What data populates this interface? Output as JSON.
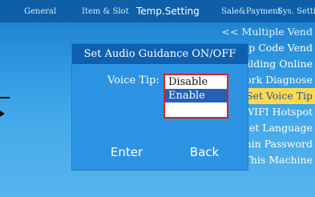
{
  "tabs": [
    "General",
    "Item & Slot",
    "Temp.Setting",
    "Sale&Payment",
    "Sys. Setting"
  ],
  "menu": {
    "items": [
      "<<     Multiple Vend",
      "Pickup Code Vend",
      "Building Online",
      "Work Diagnose",
      "Set Voice Tip",
      "WIFI Hotspot",
      "Set Language",
      "Admin Password",
      "This Machine"
    ],
    "selected_index": 4
  },
  "dialog": {
    "title": "Set Audio Guidance ON/OFF",
    "voice_label": "Voice Tip:",
    "options": [
      "Disable",
      "Enable",
      ""
    ],
    "selected_option": 1,
    "enter_label": "Enter",
    "back_label": "Back"
  },
  "colors": {
    "selected_menu_bg": "#ffd94a",
    "highlight_border": "#e0201a",
    "selected_option_bg": "#2560b8"
  }
}
